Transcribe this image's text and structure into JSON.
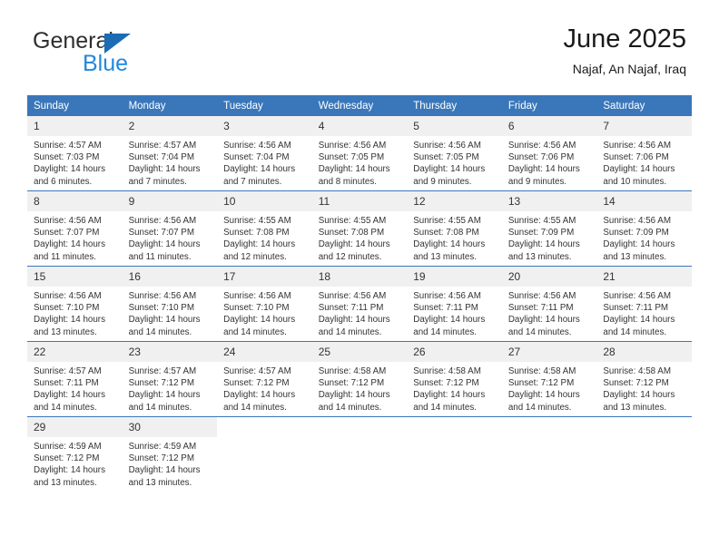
{
  "brand": {
    "name_part1": "General",
    "name_part2": "Blue",
    "triangle_color": "#1b6cb5",
    "blue_text_color": "#2288dd"
  },
  "header": {
    "title": "June 2025",
    "subtitle": "Najaf, An Najaf, Iraq"
  },
  "theme": {
    "header_row_bg": "#3a77ba",
    "header_row_text": "#ffffff",
    "daynum_bg": "#f0f0f0",
    "body_text": "#333333"
  },
  "calendar": {
    "weekday_headers": [
      "Sunday",
      "Monday",
      "Tuesday",
      "Wednesday",
      "Thursday",
      "Friday",
      "Saturday"
    ],
    "labels": {
      "sunrise_prefix": "Sunrise:",
      "sunset_prefix": "Sunset:",
      "daylight_prefix": "Daylight:"
    },
    "weeks": [
      [
        {
          "day": "1",
          "sunrise": "Sunrise: 4:57 AM",
          "sunset": "Sunset: 7:03 PM",
          "daylight_line1": "Daylight: 14 hours",
          "daylight_line2": "and 6 minutes."
        },
        {
          "day": "2",
          "sunrise": "Sunrise: 4:57 AM",
          "sunset": "Sunset: 7:04 PM",
          "daylight_line1": "Daylight: 14 hours",
          "daylight_line2": "and 7 minutes."
        },
        {
          "day": "3",
          "sunrise": "Sunrise: 4:56 AM",
          "sunset": "Sunset: 7:04 PM",
          "daylight_line1": "Daylight: 14 hours",
          "daylight_line2": "and 7 minutes."
        },
        {
          "day": "4",
          "sunrise": "Sunrise: 4:56 AM",
          "sunset": "Sunset: 7:05 PM",
          "daylight_line1": "Daylight: 14 hours",
          "daylight_line2": "and 8 minutes."
        },
        {
          "day": "5",
          "sunrise": "Sunrise: 4:56 AM",
          "sunset": "Sunset: 7:05 PM",
          "daylight_line1": "Daylight: 14 hours",
          "daylight_line2": "and 9 minutes."
        },
        {
          "day": "6",
          "sunrise": "Sunrise: 4:56 AM",
          "sunset": "Sunset: 7:06 PM",
          "daylight_line1": "Daylight: 14 hours",
          "daylight_line2": "and 9 minutes."
        },
        {
          "day": "7",
          "sunrise": "Sunrise: 4:56 AM",
          "sunset": "Sunset: 7:06 PM",
          "daylight_line1": "Daylight: 14 hours",
          "daylight_line2": "and 10 minutes."
        }
      ],
      [
        {
          "day": "8",
          "sunrise": "Sunrise: 4:56 AM",
          "sunset": "Sunset: 7:07 PM",
          "daylight_line1": "Daylight: 14 hours",
          "daylight_line2": "and 11 minutes."
        },
        {
          "day": "9",
          "sunrise": "Sunrise: 4:56 AM",
          "sunset": "Sunset: 7:07 PM",
          "daylight_line1": "Daylight: 14 hours",
          "daylight_line2": "and 11 minutes."
        },
        {
          "day": "10",
          "sunrise": "Sunrise: 4:55 AM",
          "sunset": "Sunset: 7:08 PM",
          "daylight_line1": "Daylight: 14 hours",
          "daylight_line2": "and 12 minutes."
        },
        {
          "day": "11",
          "sunrise": "Sunrise: 4:55 AM",
          "sunset": "Sunset: 7:08 PM",
          "daylight_line1": "Daylight: 14 hours",
          "daylight_line2": "and 12 minutes."
        },
        {
          "day": "12",
          "sunrise": "Sunrise: 4:55 AM",
          "sunset": "Sunset: 7:08 PM",
          "daylight_line1": "Daylight: 14 hours",
          "daylight_line2": "and 13 minutes."
        },
        {
          "day": "13",
          "sunrise": "Sunrise: 4:55 AM",
          "sunset": "Sunset: 7:09 PM",
          "daylight_line1": "Daylight: 14 hours",
          "daylight_line2": "and 13 minutes."
        },
        {
          "day": "14",
          "sunrise": "Sunrise: 4:56 AM",
          "sunset": "Sunset: 7:09 PM",
          "daylight_line1": "Daylight: 14 hours",
          "daylight_line2": "and 13 minutes."
        }
      ],
      [
        {
          "day": "15",
          "sunrise": "Sunrise: 4:56 AM",
          "sunset": "Sunset: 7:10 PM",
          "daylight_line1": "Daylight: 14 hours",
          "daylight_line2": "and 13 minutes."
        },
        {
          "day": "16",
          "sunrise": "Sunrise: 4:56 AM",
          "sunset": "Sunset: 7:10 PM",
          "daylight_line1": "Daylight: 14 hours",
          "daylight_line2": "and 14 minutes."
        },
        {
          "day": "17",
          "sunrise": "Sunrise: 4:56 AM",
          "sunset": "Sunset: 7:10 PM",
          "daylight_line1": "Daylight: 14 hours",
          "daylight_line2": "and 14 minutes."
        },
        {
          "day": "18",
          "sunrise": "Sunrise: 4:56 AM",
          "sunset": "Sunset: 7:11 PM",
          "daylight_line1": "Daylight: 14 hours",
          "daylight_line2": "and 14 minutes."
        },
        {
          "day": "19",
          "sunrise": "Sunrise: 4:56 AM",
          "sunset": "Sunset: 7:11 PM",
          "daylight_line1": "Daylight: 14 hours",
          "daylight_line2": "and 14 minutes."
        },
        {
          "day": "20",
          "sunrise": "Sunrise: 4:56 AM",
          "sunset": "Sunset: 7:11 PM",
          "daylight_line1": "Daylight: 14 hours",
          "daylight_line2": "and 14 minutes."
        },
        {
          "day": "21",
          "sunrise": "Sunrise: 4:56 AM",
          "sunset": "Sunset: 7:11 PM",
          "daylight_line1": "Daylight: 14 hours",
          "daylight_line2": "and 14 minutes."
        }
      ],
      [
        {
          "day": "22",
          "sunrise": "Sunrise: 4:57 AM",
          "sunset": "Sunset: 7:11 PM",
          "daylight_line1": "Daylight: 14 hours",
          "daylight_line2": "and 14 minutes."
        },
        {
          "day": "23",
          "sunrise": "Sunrise: 4:57 AM",
          "sunset": "Sunset: 7:12 PM",
          "daylight_line1": "Daylight: 14 hours",
          "daylight_line2": "and 14 minutes."
        },
        {
          "day": "24",
          "sunrise": "Sunrise: 4:57 AM",
          "sunset": "Sunset: 7:12 PM",
          "daylight_line1": "Daylight: 14 hours",
          "daylight_line2": "and 14 minutes."
        },
        {
          "day": "25",
          "sunrise": "Sunrise: 4:58 AM",
          "sunset": "Sunset: 7:12 PM",
          "daylight_line1": "Daylight: 14 hours",
          "daylight_line2": "and 14 minutes."
        },
        {
          "day": "26",
          "sunrise": "Sunrise: 4:58 AM",
          "sunset": "Sunset: 7:12 PM",
          "daylight_line1": "Daylight: 14 hours",
          "daylight_line2": "and 14 minutes."
        },
        {
          "day": "27",
          "sunrise": "Sunrise: 4:58 AM",
          "sunset": "Sunset: 7:12 PM",
          "daylight_line1": "Daylight: 14 hours",
          "daylight_line2": "and 14 minutes."
        },
        {
          "day": "28",
          "sunrise": "Sunrise: 4:58 AM",
          "sunset": "Sunset: 7:12 PM",
          "daylight_line1": "Daylight: 14 hours",
          "daylight_line2": "and 13 minutes."
        }
      ],
      [
        {
          "day": "29",
          "sunrise": "Sunrise: 4:59 AM",
          "sunset": "Sunset: 7:12 PM",
          "daylight_line1": "Daylight: 14 hours",
          "daylight_line2": "and 13 minutes."
        },
        {
          "day": "30",
          "sunrise": "Sunrise: 4:59 AM",
          "sunset": "Sunset: 7:12 PM",
          "daylight_line1": "Daylight: 14 hours",
          "daylight_line2": "and 13 minutes."
        },
        {
          "day": "",
          "sunrise": "",
          "sunset": "",
          "daylight_line1": "",
          "daylight_line2": ""
        },
        {
          "day": "",
          "sunrise": "",
          "sunset": "",
          "daylight_line1": "",
          "daylight_line2": ""
        },
        {
          "day": "",
          "sunrise": "",
          "sunset": "",
          "daylight_line1": "",
          "daylight_line2": ""
        },
        {
          "day": "",
          "sunrise": "",
          "sunset": "",
          "daylight_line1": "",
          "daylight_line2": ""
        },
        {
          "day": "",
          "sunrise": "",
          "sunset": "",
          "daylight_line1": "",
          "daylight_line2": ""
        }
      ]
    ]
  }
}
